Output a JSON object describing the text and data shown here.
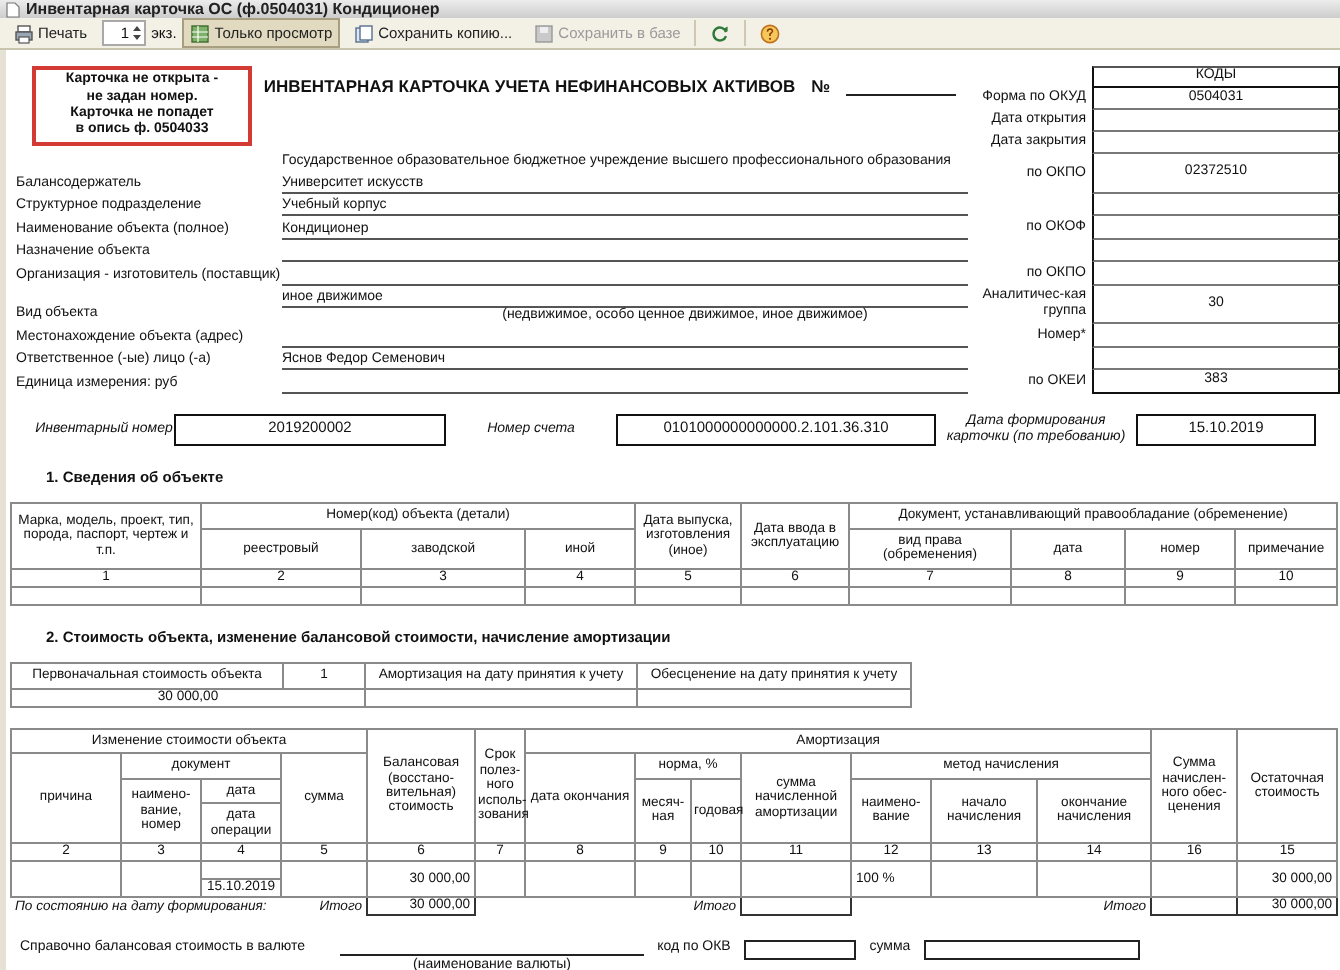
{
  "window": {
    "title": "Инвентарная карточка ОС (ф.0504031) Кондиционер"
  },
  "toolbar": {
    "print": "Печать",
    "copies": "1",
    "copies_unit": "экз.",
    "buttons": [
      {
        "label": "Только просмотр",
        "kind": "view",
        "pressed": true,
        "disabled": false
      },
      {
        "label": "Сохранить копию...",
        "kind": "copy",
        "pressed": false,
        "disabled": false
      },
      {
        "label": "Сохранить в базе",
        "kind": "disk",
        "pressed": false,
        "disabled": true
      }
    ]
  },
  "warning": [
    "Карточка не открыта -",
    "не задан номер.",
    "Карточка не попадет",
    "в опись ф. 0504033"
  ],
  "heading": {
    "title": "ИНВЕНТАРНАЯ КАРТОЧКА УЧЕТА НЕФИНАНСОВЫХ АКТИВОВ",
    "number_label": "№"
  },
  "codes": {
    "title": "КОДЫ",
    "rows": [
      {
        "label": "Форма по ОКУД",
        "code": "0504031"
      },
      {
        "label": "Дата открытия"
      },
      {
        "label": "Дата закрытия"
      }
    ]
  },
  "details": [
    {
      "label": "Балансодержатель",
      "value_lines": [
        "Государственное образовательное бюджетное учреждение высшего профессионального образования",
        "Университет искусств"
      ],
      "code_label": "по ОКПО",
      "code": "02372510"
    },
    {
      "label": "Структурное подразделение",
      "value_lines": [
        "Учебный корпус"
      ]
    },
    {
      "label": "Наименование объекта (полное)",
      "value_lines": [
        "Кондиционер"
      ],
      "code_label": "по ОКОФ"
    },
    {
      "label": "Назначение объекта"
    },
    {
      "label": "Организация - изготовитель (поставщик)",
      "code_label": "по ОКПО"
    },
    {
      "label": "Вид объекта",
      "value_lines": [
        "иное движимое"
      ],
      "hint": "(недвижимое, особо ценное движимое, иное движимое)",
      "code_label": "Аналитичес-кая группа",
      "code": "30"
    },
    {
      "label": "Местонахождение объекта (адрес)",
      "code_label": "Номер*"
    },
    {
      "label": "Ответственное (-ые) лицо (-а)",
      "value_lines": [
        "Яснов Федор Семенович"
      ]
    },
    {
      "label": "Единица измерения: руб",
      "code_label": "по ОКЕИ",
      "code": "383"
    }
  ],
  "ids": [
    {
      "label": "Инвентарный номер",
      "value": "2019200002"
    },
    {
      "label": "Номер счета",
      "value": "0101000000000000.2.101.36.310"
    },
    {
      "label": "Дата формирования карточки (по требованию)",
      "value": "15.10.2019"
    }
  ],
  "section1": {
    "title": "1. Сведения об объекте",
    "groups": [
      "Номер(код) объекта (детали)",
      "Документ, устанавливающий правообладание (обременение)"
    ],
    "columns": [
      "Марка, модель, проект, тип, порода, паспорт, чертеж и т.п.",
      "реестровый",
      "заводской",
      "иной",
      "Дата выпуска, изготовления (иное)",
      "Дата ввода в эксплуатацию",
      "вид права (обременения)",
      "дата",
      "номер",
      "примечание"
    ],
    "numbers": [
      "1",
      "2",
      "3",
      "4",
      "5",
      "6",
      "7",
      "8",
      "9",
      "10"
    ]
  },
  "section2": {
    "title": "2. Стоимость объекта, изменение балансовой стоимости, начисление амортизации",
    "initial": {
      "headers": [
        "Первоначальная стоимость объекта",
        "1",
        "Амортизация на дату принятия к учету",
        "Обесценение на дату принятия к учету"
      ],
      "value": "30 000,00"
    },
    "groups": [
      "Изменение стоимости объекта",
      "документ",
      "Амортизация",
      "норма, %",
      "метод начисления"
    ],
    "columns": [
      "причина",
      "наимено-вание, номер",
      "дата",
      "сумма",
      "Балансовая (восстано-вительная) стоимость",
      "Срок полез-ного исполь-зования",
      "дата окончания",
      "месяч-ная",
      "годовая",
      "сумма начисленной амортизации",
      "наимено-вание",
      "начало начисления",
      "окончание начисления",
      "Сумма начислен-ного обес-ценения",
      "Остаточная стоимость"
    ],
    "operation_date_label": "дата операции",
    "numbers": [
      "2",
      "3",
      "4",
      "5",
      "6",
      "7",
      "8",
      "9",
      "10",
      "11",
      "12",
      "13",
      "14",
      "16",
      "15"
    ],
    "row": {
      "balance": "30 000,00",
      "method": "100 %",
      "residual": "30 000,00",
      "operation_date": "15.10.2019"
    },
    "totals": {
      "label": "По состоянию на дату формирования:",
      "total_labels": [
        "Итого",
        "Итого",
        "Итого"
      ],
      "balance": "30 000,00",
      "residual": "30 000,00"
    }
  },
  "currency": {
    "label": "Справочно балансовая стоимость в валюте",
    "caption": "(наименование валюты)",
    "code_label": "код по ОКВ",
    "sum_label": "сумма"
  }
}
